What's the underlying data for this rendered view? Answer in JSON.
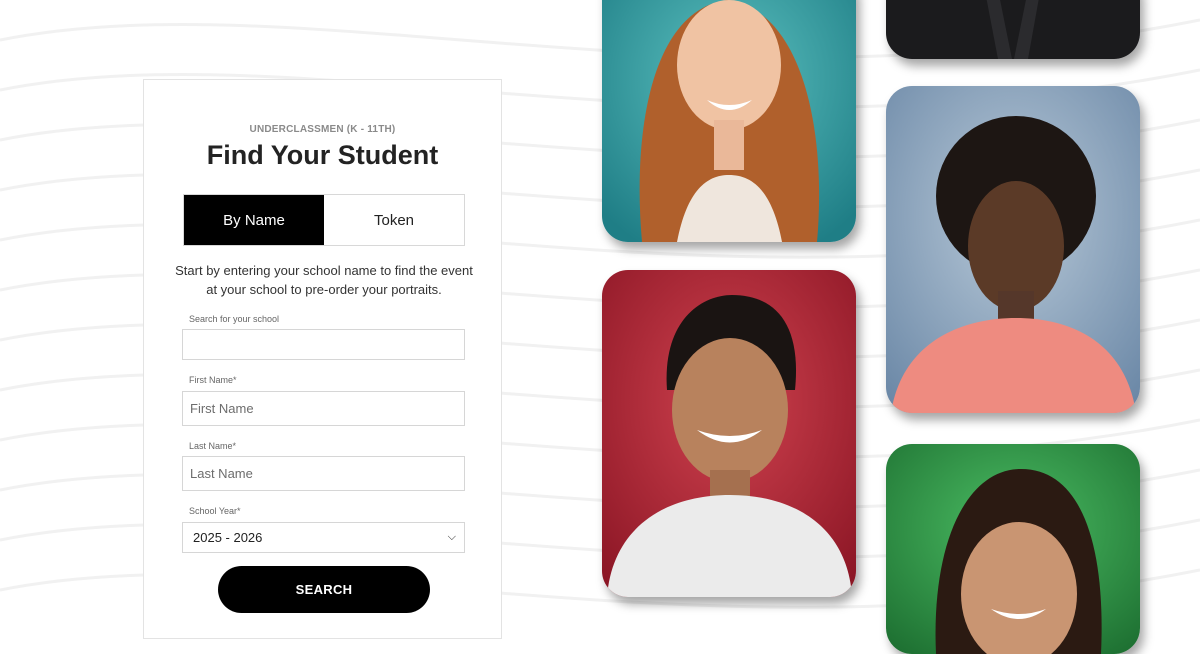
{
  "finder": {
    "eyebrow": "UNDERCLASSMEN (K - 11TH)",
    "title": "Find Your Student",
    "tabs": [
      {
        "label": "By Name",
        "active": true
      },
      {
        "label": "Token",
        "active": false
      }
    ],
    "intro": "Start by entering your school name to find the event at your school to pre-order your portraits.",
    "school_label": "Search for your school",
    "school_value": "",
    "first_name_label": "First Name*",
    "first_name_placeholder": "First Name",
    "last_name_label": "Last Name*",
    "last_name_placeholder": "Last Name",
    "school_year_label": "School Year*",
    "school_year_value": "2025 - 2026",
    "search_label": "SEARCH"
  },
  "colors": {
    "accent": "#000000",
    "photo_teal": "#2a9d9f",
    "photo_red": "#b8283a",
    "photo_blue": "#8aa3bd",
    "photo_green": "#2e9b46"
  }
}
